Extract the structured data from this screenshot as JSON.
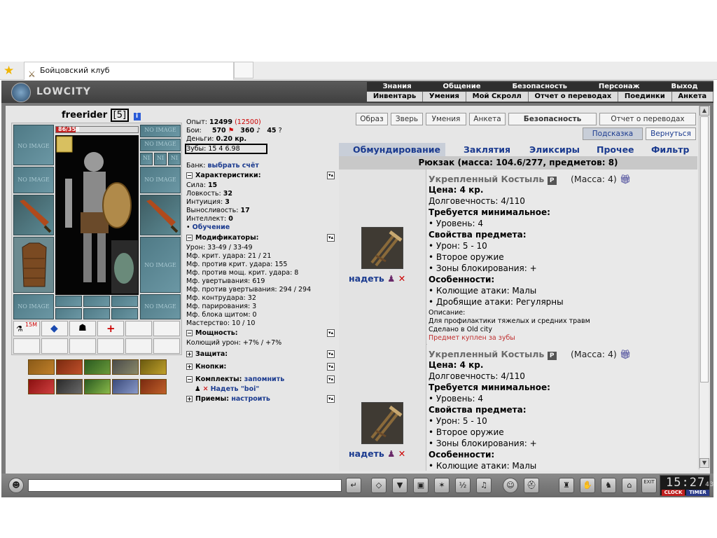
{
  "browser": {
    "tab_title": "Бойцовский клуб"
  },
  "topnav": {
    "logo": "LOWCITY",
    "menu1": [
      "Знания",
      "Общение",
      "Безопасность",
      "Персонаж",
      "Выход"
    ],
    "menu2": [
      "Инвентарь",
      "Умения",
      "Мой Скролл",
      "Отчет о переводах",
      "Поединки",
      "Анкета"
    ]
  },
  "character": {
    "name": "freerider",
    "level": "[5]",
    "hp_text": "86/358",
    "hp_fraction": 0.24,
    "no_image": "NO IMAGE",
    "ni": "NI",
    "belt_label": "15M"
  },
  "stats": {
    "exp_label": "Опыт:",
    "exp": "12499",
    "exp_next": "(12500)",
    "fights_label": "Бои:",
    "wins": "570",
    "losses": "360",
    "draws": "45",
    "money_label": "Деньги:",
    "money": "0.20 кр.",
    "teeth_label": "Зубы:",
    "teeth": "15 4 6.98",
    "bank_label": "Банк:",
    "bank_link": "выбрать счёт",
    "char_header": "Характеристики:",
    "attrs": [
      {
        "label": "Сила:",
        "value": "15"
      },
      {
        "label": "Ловкость:",
        "value": "32"
      },
      {
        "label": "Интуиция:",
        "value": "3"
      },
      {
        "label": "Выносливость:",
        "value": "17"
      },
      {
        "label": "Интеллект:",
        "value": "0"
      }
    ],
    "training": "Обучение",
    "mods_header": "Модификаторы:",
    "mods": [
      "Урон: 33-49 / 33-49",
      "Мф. крит. удара: 21 / 21",
      "Мф. против крит. удара: 155",
      "Мф. против мощ. крит. удара: 8",
      "Мф. увертывания: 619",
      "Мф. против увертывания: 294 / 294",
      "Мф. контрудара: 32",
      "Мф. парирования: 3",
      "Мф. блока щитом: 0",
      "Мастерство: 10 / 10"
    ],
    "power_header": "Мощность:",
    "power_line": "Колющий урон: +7% / +7%",
    "protection_header": "Защита:",
    "buttons_header": "Кнопки:",
    "sets_header": "Комплекты:",
    "sets_link": "запомнить",
    "wear_set": "Надеть \"boi\"",
    "tricks_header": "Приемы:",
    "tricks_link": "настроить"
  },
  "rightnav": {
    "buttons": [
      "Образ",
      "Зверь",
      "Умения",
      "Анкета",
      "Безопасность",
      "Отчет о переводах"
    ],
    "hint": "Подсказка",
    "back": "Вернуться"
  },
  "inventory": {
    "tabs": [
      "Обмундирование",
      "Заклятия",
      "Эликсиры",
      "Прочее",
      "Фильтр"
    ],
    "rucksack": "Рюкзак (масса: 104.6/277, предметов: 8)",
    "wear_label": "надеть",
    "items": [
      {
        "name": "Укрепленный Костыль",
        "mass": "(Масса: 4)",
        "price": "Цена: 4 кр.",
        "durability": "Долговечность: 4/110",
        "req_header": "Требуется минимальное:",
        "req": "• Уровень: 4",
        "props_header": "Свойства предмета:",
        "props": [
          "• Урон: 5 - 10",
          "• Второе оружие",
          "• Зоны блокирования: +"
        ],
        "feat_header": "Особенности:",
        "feats": [
          "• Колющие атаки: Малы",
          "• Дробящие атаки: Регулярны"
        ],
        "desc_label": "Описание:",
        "desc": "Для профилактики тяжелых и средних травм",
        "made": "Сделано в Old city",
        "bought": "Предмет куплен за зубы"
      },
      {
        "name": "Укрепленный Костыль",
        "mass": "(Масса: 4)",
        "price": "Цена: 4 кр.",
        "durability": "Долговечность: 4/110",
        "req_header": "Требуется минимальное:",
        "req": "• Уровень: 4",
        "props_header": "Свойства предмета:",
        "props": [
          "• Урон: 5 - 10",
          "• Второе оружие",
          "• Зоны блокирования: +"
        ],
        "feat_header": "Особенности:",
        "feats": [
          "• Колющие атаки: Малы"
        ]
      }
    ]
  },
  "chat": {
    "clock": "15:27",
    "clock_sec": "43",
    "clock_btn": "CLOCK",
    "timer_btn": "TIMER",
    "exit": "EXIT"
  }
}
